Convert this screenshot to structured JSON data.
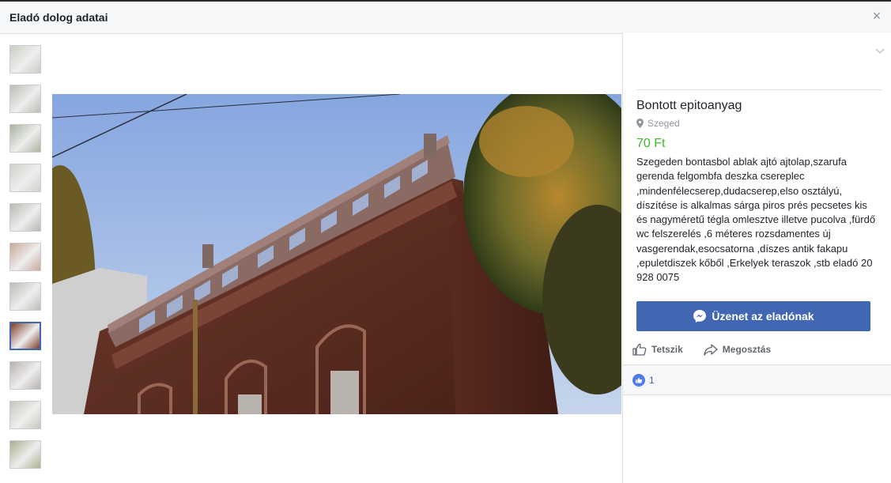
{
  "dialog": {
    "title": "Eladó dolog adatai",
    "close_icon": "close-icon",
    "close_glyph": "×"
  },
  "thumbnails": [
    {
      "icon": "photo-thumbnail",
      "tone": "#c8cec3"
    },
    {
      "icon": "photo-thumbnail",
      "tone": "#b9bdb3"
    },
    {
      "icon": "photo-thumbnail",
      "tone": "#aab39d"
    },
    {
      "icon": "photo-thumbnail",
      "tone": "#cfcfcb"
    },
    {
      "icon": "photo-thumbnail",
      "tone": "#b7b7b2"
    },
    {
      "icon": "photo-thumbnail",
      "tone": "#c9a79a"
    },
    {
      "icon": "photo-thumbnail",
      "tone": "#bcbcb7"
    },
    {
      "icon": "photo-thumbnail",
      "tone": "#7d3e2c",
      "active": true
    },
    {
      "icon": "photo-thumbnail",
      "tone": "#b8b1ad"
    },
    {
      "icon": "photo-thumbnail",
      "tone": "#c6c8bb"
    },
    {
      "icon": "photo-thumbnail",
      "tone": "#a9b08f"
    }
  ],
  "listing": {
    "title": "Bontott epitoanyag",
    "location": "Szeged",
    "price": "70 Ft",
    "description": "Szegeden bontasbol ablak ajtó ajtolap,szarufa gerenda felgombfa deszka csereplec ,mindenfélecserep,dudacserep,elso osztályú, díszítése is alkalmas sárga piros prés pecsetes kis és nagyméretű tégla omlesztve illetve pucolva ,fürdő wc felszerelés ,6 méteres rozsdamentes új vasgerendak,esocsatorna ,díszes antik fakapu ,epuletdiszek kőből ,Erkelyek teraszok ,stb eladó 20 928 0075"
  },
  "actions": {
    "message_button": "Üzenet az eladónak",
    "like": "Tetszik",
    "share": "Megosztás"
  },
  "reactions": {
    "count": "1"
  },
  "colors": {
    "accent": "#4267b2",
    "price_green": "#42b72a",
    "header_bg": "#f6f7f9"
  }
}
